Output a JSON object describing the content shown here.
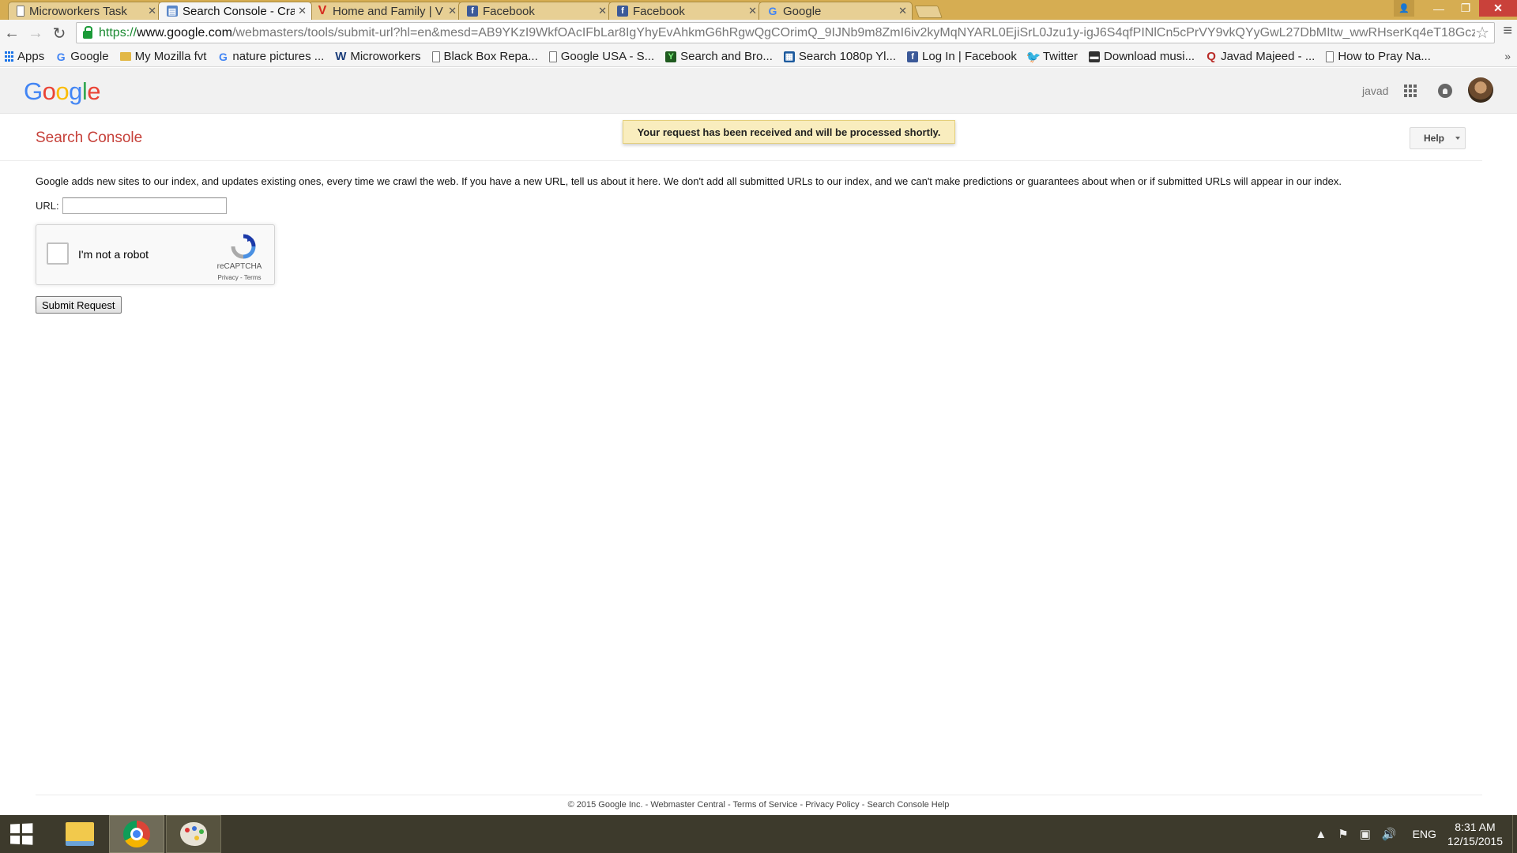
{
  "browser": {
    "tabs": [
      {
        "title": "Microworkers Task",
        "favicon": "doc-icon",
        "active": false
      },
      {
        "title": "Search Console - Cra",
        "favicon": "search-console-icon",
        "active": true
      },
      {
        "title": "Home and Family | V",
        "favicon": "v-icon",
        "active": false
      },
      {
        "title": "Facebook",
        "favicon": "facebook-icon",
        "active": false
      },
      {
        "title": "Facebook",
        "favicon": "facebook-icon",
        "active": false
      },
      {
        "title": "Google",
        "favicon": "google-icon",
        "active": false
      }
    ],
    "url_scheme": "https://",
    "url_host": "www.google.com",
    "url_path": "/webmasters/tools/submit-url?hl=en&mesd=AB9YKzI9WkfOAcIFbLar8IgYhyEvAhkmG6hRgwQgCOrimQ_9IJNb9m8ZmI6iv2kyMqNYARL0EjiSrL0Jzu1y-igJ6S4qfPINlCn5cPrVY9vkQYyGwL27DbMItw_wwRHserKq4eT18Gcz",
    "bookmarks": [
      {
        "label": "Apps",
        "icon": "apps-icon"
      },
      {
        "label": "Google",
        "icon": "google-icon"
      },
      {
        "label": "My Mozilla fvt",
        "icon": "folder-icon"
      },
      {
        "label": "nature pictures ...",
        "icon": "google-icon"
      },
      {
        "label": "Microworkers",
        "icon": "w-icon"
      },
      {
        "label": "Black Box Repa...",
        "icon": "doc-icon"
      },
      {
        "label": "Google USA - S...",
        "icon": "doc-icon"
      },
      {
        "label": "Search and Bro...",
        "icon": "y-icon"
      },
      {
        "label": "Search 1080p Yl...",
        "icon": "search-icon"
      },
      {
        "label": "Log In | Facebook",
        "icon": "facebook-icon"
      },
      {
        "label": "Twitter",
        "icon": "twitter-icon"
      },
      {
        "label": "Download musi...",
        "icon": "download-icon"
      },
      {
        "label": "Javad Majeed - ...",
        "icon": "quora-icon"
      },
      {
        "label": "How to Pray Na...",
        "icon": "doc-icon"
      }
    ],
    "more_chevron": "»"
  },
  "header": {
    "logo_letters": [
      "G",
      "o",
      "o",
      "g",
      "l",
      "e"
    ],
    "logo_colors": [
      "#4285f4",
      "#ea4335",
      "#fbbc05",
      "#4285f4",
      "#34a853",
      "#ea4335"
    ],
    "username": "javad"
  },
  "console": {
    "title": "Search Console",
    "notice": "Your request has been received and will be processed shortly.",
    "help_label": "Help"
  },
  "form": {
    "description": "Google adds new sites to our index, and updates existing ones, every time we crawl the web. If you have a new URL, tell us about it here. We don't add all submitted URLs to our index, and we can't make predictions or guarantees about when or if submitted URLs will appear in our index.",
    "url_label": "URL:",
    "url_value": "",
    "captcha_label": "I'm not a robot",
    "captcha_brand": "reCAPTCHA",
    "captcha_links": "Privacy - Terms",
    "submit_label": "Submit Request"
  },
  "footer": {
    "copyright": "© 2015 Google Inc.",
    "links": [
      "Webmaster Central",
      "Terms of Service",
      "Privacy Policy",
      "Search Console Help"
    ],
    "separator": " - "
  },
  "taskbar": {
    "language": "ENG",
    "time": "8:31 AM",
    "date": "12/15/2015"
  },
  "colors": {
    "console_title": "#c6413a",
    "notice_bg": "#f9edbe",
    "tabstrip": "#d6ad52",
    "taskbar": "#3d3a2c"
  }
}
